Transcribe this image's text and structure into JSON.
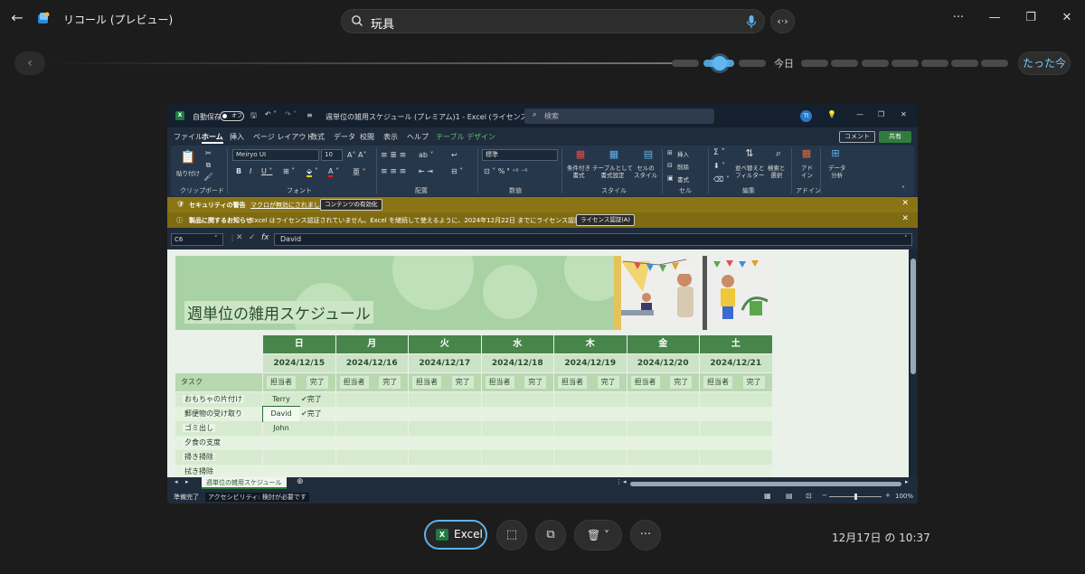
{
  "app": {
    "title": "リコール (プレビュー)",
    "search_value": "玩具"
  },
  "timeline": {
    "today_label": "今日",
    "now_button": "たった今"
  },
  "excel": {
    "autosave_label": "自動保存",
    "autosave_state": "オフ",
    "doc_title": "週単位の雑用スケジュール (プレミアム)1  -  Excel (ライセンスのない…",
    "search_placeholder": "検索",
    "avatar_initial": "Tt",
    "menu": [
      "ファイル",
      "ホーム",
      "挿入",
      "ページ レイアウト",
      "数式",
      "データ",
      "校閲",
      "表示",
      "ヘルプ",
      "テーブル デザイン"
    ],
    "comment_button": "コメント",
    "share_button": "共有",
    "ribbon": {
      "paste": "貼り付け",
      "clipboard": "クリップボード",
      "font_name": "Meiryo UI",
      "font_size": "10",
      "font_group": "フォント",
      "align_group": "配置",
      "number_format": "標準",
      "number_group": "数値",
      "cond_format": "条件付き\n書式",
      "table_format": "テーブルとして\n書式設定",
      "cell_style": "セルの\nスタイル",
      "style_group": "スタイル",
      "insert": "挿入",
      "delete": "削除",
      "format": "書式",
      "cell_group": "セル",
      "sort_filter": "並べ替えと\nフィルター",
      "find_select": "検索と\n選択",
      "edit_group": "編集",
      "addin": "アド\nイン",
      "addin_group": "アドイン",
      "data_analysis": "データ\n分析"
    },
    "security_bar": {
      "title": "セキュリティの警告",
      "message": "マクロが無効にされました。",
      "button": "コンテンツの有効化"
    },
    "license_bar": {
      "title": "製品に関するお知らせ",
      "message": "Excel はライセンス認証されていません。Excel を継続して使えるように、2024年12月22日 までにライセンス認証を行ってください。",
      "button": "ライセンス認証(A)"
    },
    "name_box": "C6",
    "formula": "David",
    "sheet": {
      "title": "週単位の雑用スケジュール",
      "days": [
        "日",
        "月",
        "火",
        "水",
        "木",
        "金",
        "土"
      ],
      "dates": [
        "2024/12/15",
        "2024/12/16",
        "2024/12/17",
        "2024/12/18",
        "2024/12/19",
        "2024/12/20",
        "2024/12/21"
      ],
      "task_header": "タスク",
      "assignee_header": "担当者",
      "done_header": "完了",
      "tasks": [
        "おもちゃの片付け",
        "郵便物の受け取り",
        "ゴミ出し",
        "夕食の支度",
        "掃き掃除",
        "拭き掃除"
      ],
      "assignees": [
        "Terry",
        "David",
        "John",
        "",
        "",
        ""
      ],
      "done": [
        "完了",
        "完了",
        "",
        "",
        "",
        ""
      ]
    },
    "sheet_tab": "週単位の雑用スケジュール",
    "status_ready": "準備完了",
    "status_accessibility": "アクセシビリティ: 検討が必要です",
    "zoom": "100%"
  },
  "bottom": {
    "excel_button": "Excel",
    "timestamp": "12月17日 の 10:37"
  },
  "colors": {
    "accent": "#60b8f0",
    "header_green": "#48854a",
    "warning_bar": "#8a7414"
  }
}
